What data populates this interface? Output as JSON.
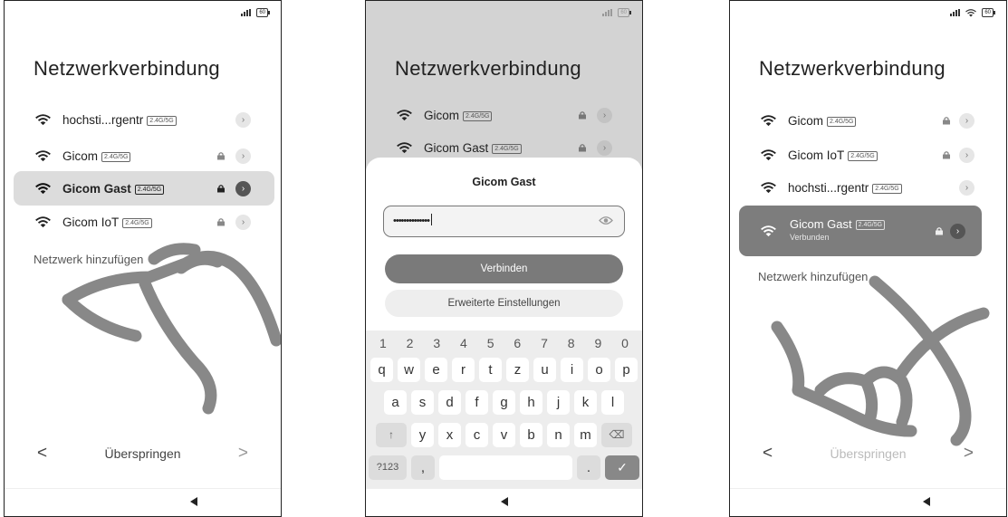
{
  "screens": [
    {
      "battery": "60",
      "title": "Netzwerkverbindung",
      "networks": [
        {
          "name": "hochsti...rgentr",
          "badge": "2.4G/5G",
          "locked": false,
          "highlighted": false
        },
        {
          "name": "Gicom",
          "badge": "2.4G/5G",
          "locked": true,
          "highlighted": false
        },
        {
          "name": "Gicom Gast",
          "badge": "2.4G/5G",
          "locked": true,
          "highlighted": true
        },
        {
          "name": "Gicom IoT",
          "badge": "2.4G/5G",
          "locked": true,
          "highlighted": false
        }
      ],
      "add_network": "Netzwerk hinzufügen",
      "skip": "Überspringen",
      "prev": "<",
      "next": ">"
    },
    {
      "battery": "60",
      "title": "Netzwerkverbindung",
      "networks": [
        {
          "name": "Gicom",
          "badge": "2.4G/5G",
          "locked": true
        },
        {
          "name": "Gicom Gast",
          "badge": "2.4G/5G",
          "locked": true
        }
      ],
      "dialog": {
        "title": "Gicom Gast",
        "password": "••••••••••••••",
        "connect": "Verbinden",
        "advanced": "Erweiterte Einstellungen"
      },
      "keyboard": {
        "numbers": [
          "1",
          "2",
          "3",
          "4",
          "5",
          "6",
          "7",
          "8",
          "9",
          "0"
        ],
        "row1": [
          "q",
          "w",
          "e",
          "r",
          "t",
          "z",
          "u",
          "i",
          "o",
          "p"
        ],
        "row2": [
          "a",
          "s",
          "d",
          "f",
          "g",
          "h",
          "j",
          "k",
          "l"
        ],
        "row3": [
          "y",
          "x",
          "c",
          "v",
          "b",
          "n",
          "m"
        ],
        "shift": "↑",
        "delete": "⌫",
        "num_switch": "?123",
        "comma": ",",
        "period": ".",
        "enter": "✓"
      }
    },
    {
      "battery": "60",
      "title": "Netzwerkverbindung",
      "networks": [
        {
          "name": "Gicom",
          "badge": "2.4G/5G",
          "locked": true
        },
        {
          "name": "Gicom IoT",
          "badge": "2.4G/5G",
          "locked": true
        },
        {
          "name": "hochsti...rgentr",
          "badge": "2.4G/5G",
          "locked": false
        }
      ],
      "connected": {
        "name": "Gicom Gast",
        "badge": "2.4G/5G",
        "status": "Verbunden"
      },
      "add_network": "Netzwerk hinzufügen",
      "skip": "Überspringen",
      "prev": "<",
      "next": ">"
    }
  ]
}
